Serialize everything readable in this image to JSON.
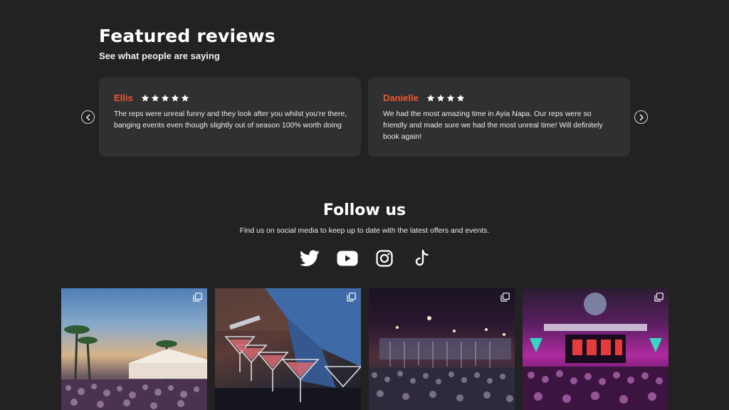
{
  "reviews_section": {
    "title": "Featured reviews",
    "subtitle": "See what people are saying",
    "accent_color": "#f0562e",
    "reviews": [
      {
        "name": "Ellis",
        "rating": 5,
        "text": "The reps were unreal funny and they look after you whilst you're there, banging events even though slightly out of season 100% worth doing"
      },
      {
        "name": "Danielle",
        "rating": 4,
        "text": "We had the most amazing time in Ayia Napa. Our reps were so friendly and made sure we had the most unreal time! Will definitely book again!"
      }
    ]
  },
  "follow_section": {
    "title": "Follow us",
    "text": "Find us on social media to keep up to date with the latest offers and events.",
    "social_icons": [
      "twitter-icon",
      "youtube-icon",
      "instagram-icon",
      "tiktok-icon"
    ]
  },
  "gallery": {
    "tiles": [
      {
        "icon": "multiple-images-icon"
      },
      {
        "icon": "multiple-images-icon"
      },
      {
        "icon": "multiple-images-icon"
      },
      {
        "icon": "multiple-images-icon"
      }
    ]
  }
}
